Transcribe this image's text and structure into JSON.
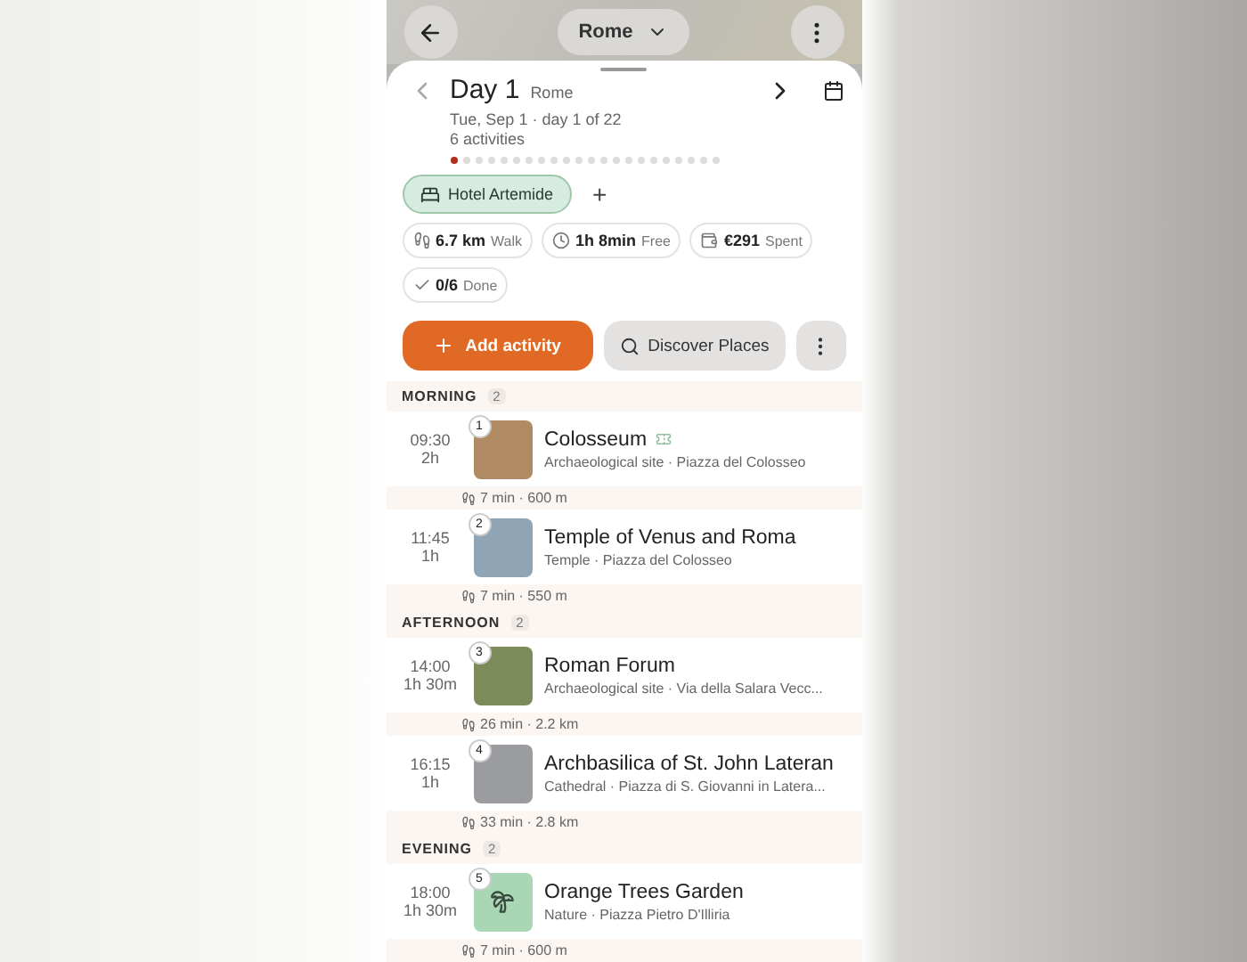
{
  "map_bar": {
    "city": "Rome"
  },
  "header": {
    "title": "Day 1",
    "city": "Rome",
    "date": "Tue, Sep 1 · day 1 of 22",
    "count": "6 activities",
    "days": [
      {
        "selected": true
      },
      {
        "selected": false
      },
      {
        "selected": false
      },
      {
        "selected": false
      },
      {
        "selected": false
      },
      {
        "selected": false
      },
      {
        "selected": false
      },
      {
        "selected": false
      },
      {
        "selected": false
      },
      {
        "selected": false
      },
      {
        "selected": false
      },
      {
        "selected": false
      },
      {
        "selected": false
      },
      {
        "selected": false
      },
      {
        "selected": false
      },
      {
        "selected": false
      },
      {
        "selected": false
      },
      {
        "selected": false
      },
      {
        "selected": false
      },
      {
        "selected": false
      },
      {
        "selected": false
      },
      {
        "selected": false
      }
    ]
  },
  "hotel": {
    "name": "Hotel Artemide",
    "add": "+"
  },
  "stats": [
    {
      "kind": "walk",
      "value": "6.7 km",
      "label": "Walk"
    },
    {
      "kind": "clock",
      "value": "1h 8min",
      "label": "Free"
    },
    {
      "kind": "wallet",
      "value": "€291",
      "label": "Spent"
    },
    {
      "kind": "check",
      "value": "0/6",
      "label": "Done"
    }
  ],
  "actions": {
    "add": "Add activity",
    "discover": "Discover Places"
  },
  "sections": [
    {
      "title": "MORNING",
      "count": "2",
      "items": [
        {
          "time": "09:30",
          "duration": "2h",
          "number": "1",
          "name": "Colosseum",
          "ticket": true,
          "kind": "photo",
          "color": "#b08a62",
          "meta": "Archaeological site · Piazza del Colosseo",
          "transit": "7 min · 600 m"
        },
        {
          "time": "11:45",
          "duration": "1h",
          "number": "2",
          "name": "Temple of Venus and Roma",
          "ticket": false,
          "kind": "photo",
          "color": "#8fa4b5",
          "meta": "Temple · Piazza del Colosseo",
          "transit": "7 min · 550 m"
        }
      ]
    },
    {
      "title": "AFTERNOON",
      "count": "2",
      "items": [
        {
          "time": "14:00",
          "duration": "1h 30m",
          "number": "3",
          "name": "Roman Forum",
          "ticket": false,
          "kind": "photo",
          "color": "#7d8a5a",
          "meta": "Archaeological site · Via della Salara Vecc...",
          "transit": "26 min · 2.2 km"
        },
        {
          "time": "16:15",
          "duration": "1h",
          "number": "4",
          "name": "Archbasilica of St. John Lateran",
          "ticket": false,
          "kind": "photo",
          "color": "#9a9ca0",
          "meta": "Cathedral · Piazza di S. Giovanni in Latera...",
          "transit": "33 min · 2.8 km"
        }
      ]
    },
    {
      "title": "EVENING",
      "count": "2",
      "items": [
        {
          "time": "18:00",
          "duration": "1h 30m",
          "number": "5",
          "name": "Orange Trees Garden",
          "ticket": false,
          "kind": "icon",
          "color": "#a9d6b4",
          "meta": "Nature · Piazza Pietro D'Illiria",
          "transit": "7 min · 600 m"
        }
      ]
    }
  ]
}
